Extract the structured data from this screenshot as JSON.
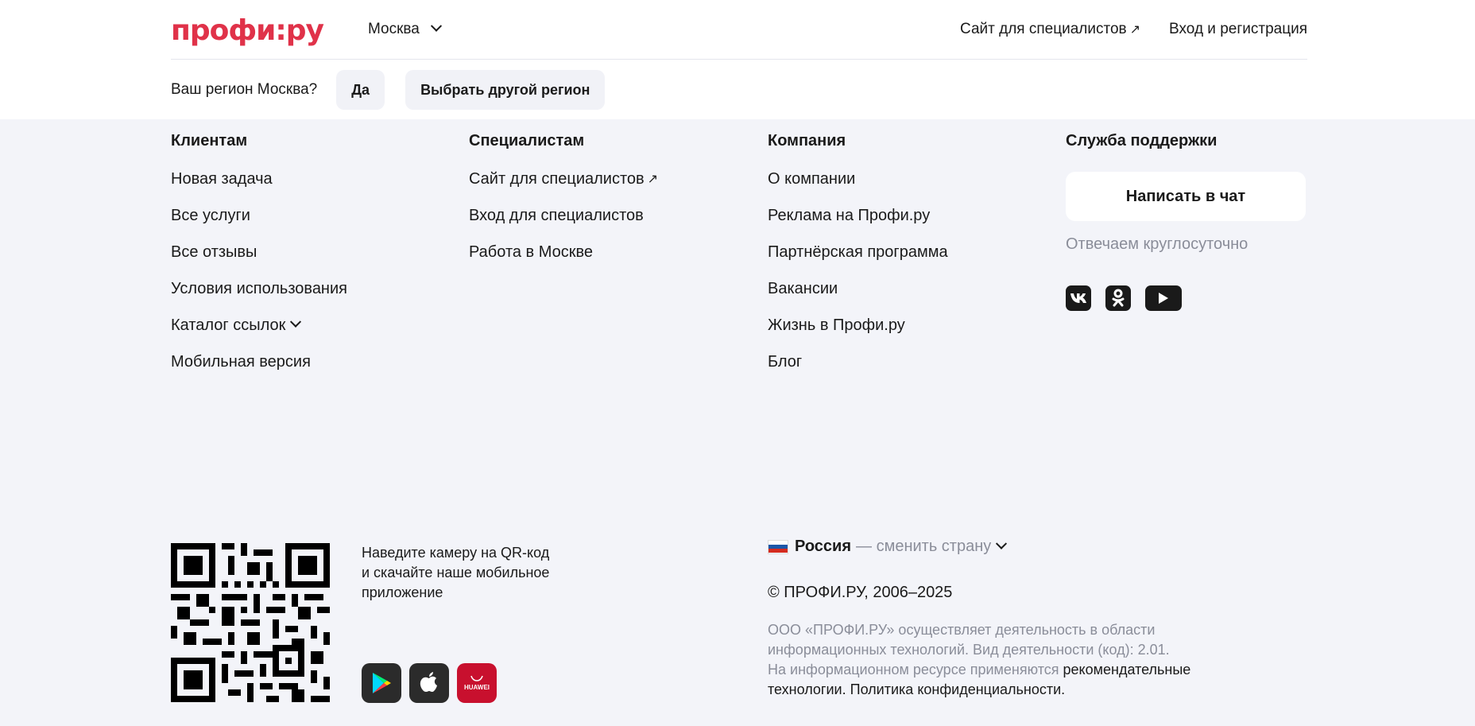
{
  "header": {
    "logo_text": "профи:ру",
    "city": "Москва",
    "specialists_link": "Сайт для специалистов",
    "login_link": "Вход и регистрация",
    "external_arrow": "↗"
  },
  "region": {
    "question": "Ваш регион Москва?",
    "yes_label": "Да",
    "other_label": "Выбрать другой регион"
  },
  "clients": {
    "title": "Клиентам",
    "items": [
      "Новая задача",
      "Все услуги",
      "Все отзывы",
      "Условия использования",
      "Каталог ссылок",
      "Мобильная версия"
    ]
  },
  "specialists": {
    "title": "Специалистам",
    "items": [
      "Сайт для специалистов",
      "Вход для специалистов",
      "Работа в Москве"
    ]
  },
  "company": {
    "title": "Компания",
    "items": [
      "О компании",
      "Реклама на Профи.ру",
      "Партнёрская программа",
      "Вакансии",
      "Жизнь в Профи.ру",
      "Блог"
    ]
  },
  "support": {
    "title": "Служба поддержки",
    "chat_label": "Написать в чат",
    "note": "Отвечаем круглосуточно",
    "socials": [
      "vk-icon",
      "ok-icon",
      "youtube-icon"
    ]
  },
  "app": {
    "qr_text_1": "Наведите камеру на QR-код",
    "qr_text_2": "и скачайте наше мобильное",
    "qr_text_3": "приложение",
    "stores": [
      "google-play-icon",
      "apple-icon",
      "huawei-appgallery-icon"
    ],
    "huawei_label": "HUAWEI"
  },
  "footer": {
    "country": "Россия",
    "change_country": "— сменить страну",
    "copyright": "© ПРОФИ.РУ, 2006–2025",
    "legal_1": "ООО «ПРОФИ.РУ» осуществляет деятельность в области",
    "legal_2": "информационных технологий. Вид деятельности (код): 2.01.",
    "legal_3": "На информационном ресурсе применяются",
    "legal_link_1": "рекомендательные",
    "legal_link_2": "технологии.",
    "legal_link_3": "Политика конфиденциальности."
  },
  "colors": {
    "brand": "#e03249",
    "background": "#f3f4f9",
    "muted": "#8a8d99"
  }
}
